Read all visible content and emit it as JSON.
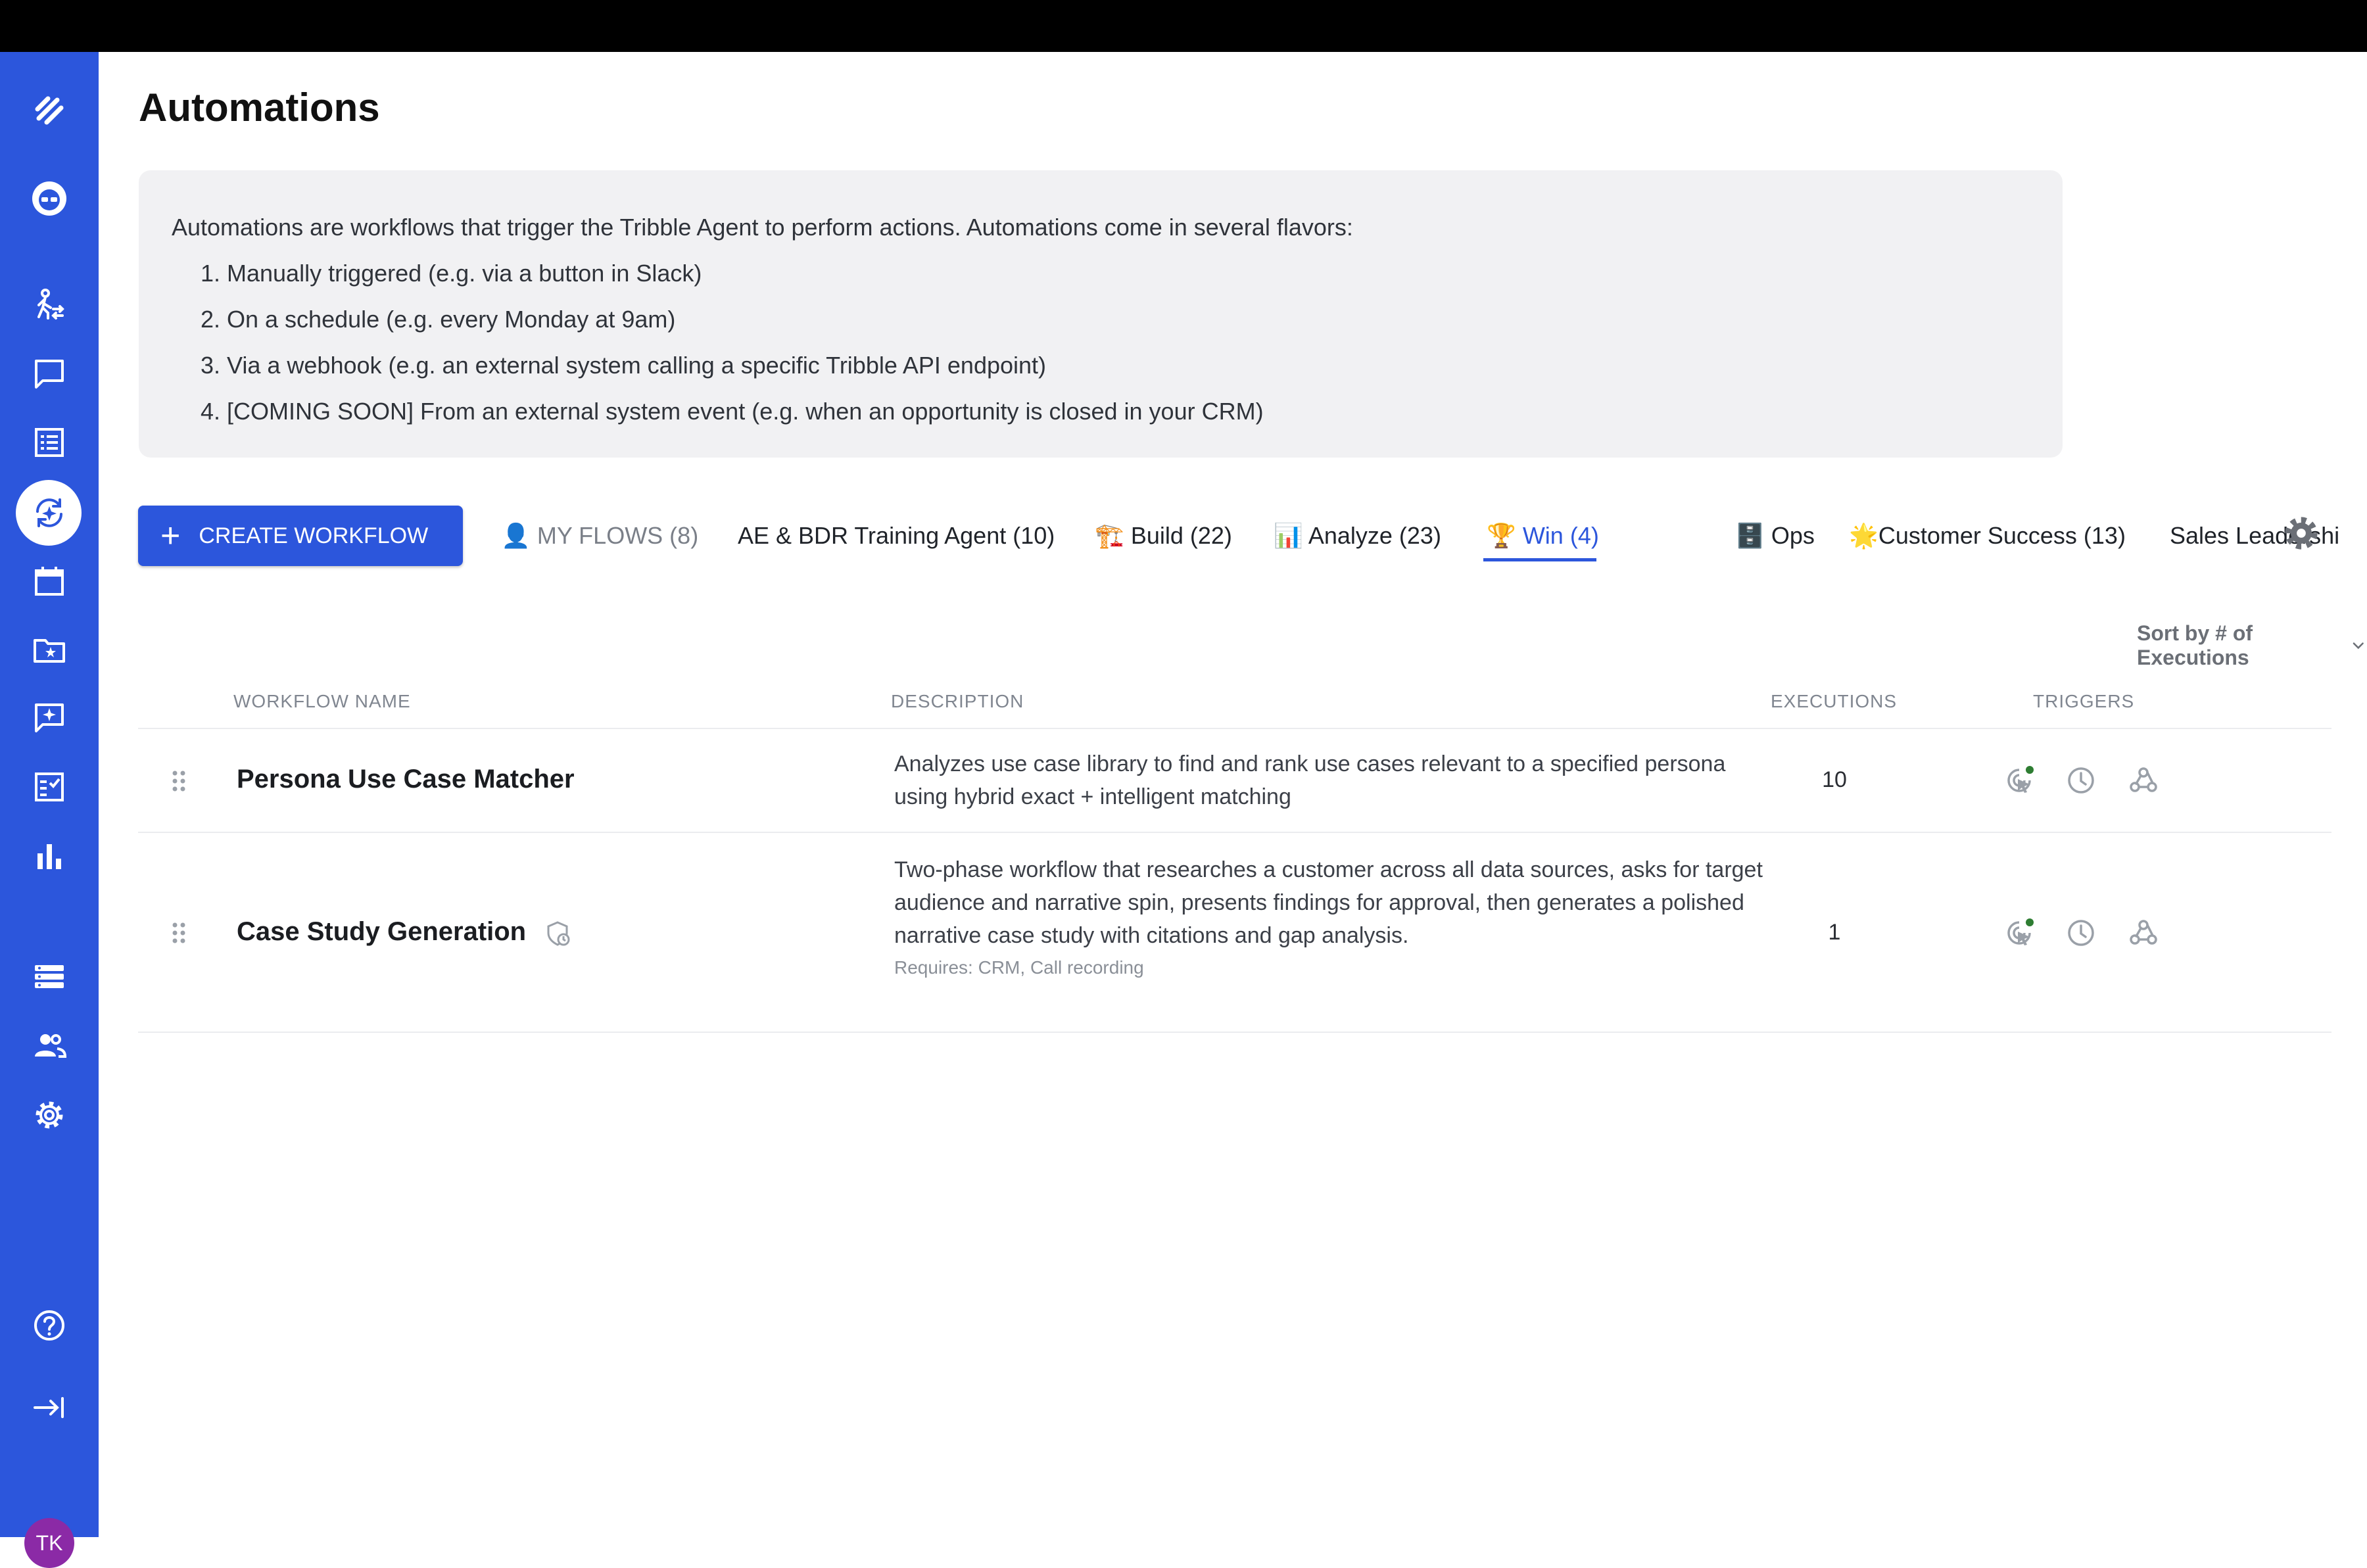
{
  "page": {
    "title": "Automations"
  },
  "info": {
    "intro": "Automations are workflows that trigger the Tribble Agent to perform actions. Automations come in several flavors:",
    "items": [
      "Manually triggered (e.g. via a button in Slack)",
      "On a schedule (e.g. every Monday at 9am)",
      "Via a webhook (e.g. an external system calling a specific Tribble API endpoint)",
      "[COMING SOON] From an external system event (e.g. when an opportunity is closed in your CRM)"
    ]
  },
  "toolbar": {
    "create_label": "CREATE WORKFLOW",
    "sort_label": "Sort by # of Executions"
  },
  "tabs": [
    {
      "label": "👤 MY FLOWS (8)",
      "state": "muted"
    },
    {
      "label": "AE & BDR Training Agent (10)",
      "state": "normal"
    },
    {
      "label": "🏗️ Build (22)",
      "state": "normal"
    },
    {
      "label": "📊 Analyze (23)",
      "state": "normal"
    },
    {
      "label": "🏆 Win (4)",
      "state": "active"
    },
    {
      "label": "🗄️ Ops",
      "state": "normal"
    },
    {
      "label": "🌟Customer Success (13)",
      "state": "normal"
    },
    {
      "label": "Sales Leadershi",
      "state": "normal"
    }
  ],
  "table": {
    "columns": {
      "name": "WORKFLOW NAME",
      "description": "DESCRIPTION",
      "executions": "EXECUTIONS",
      "triggers": "TRIGGERS"
    },
    "rows": [
      {
        "name": "Persona Use Case Matcher",
        "description": "Analyzes use case library to find and rank use cases relevant to a specified persona using hybrid exact + intelligent matching",
        "requires": "",
        "executions": "10",
        "triggers": [
          "manual-trigger-icon",
          "schedule-icon",
          "webhook-icon"
        ],
        "manual_active": true
      },
      {
        "name": "Case Study Generation",
        "description": "Two-phase workflow that researches a customer across all data sources, asks for target audience and narrative spin, presents findings for approval, then generates a polished narrative case study with citations and gap analysis.",
        "requires": "Requires: CRM, Call recording",
        "executions": "1",
        "triggers": [
          "manual-trigger-icon",
          "schedule-icon",
          "webhook-icon"
        ],
        "manual_active": true
      }
    ]
  },
  "user": {
    "initials": "TK"
  },
  "colors": {
    "brand": "#2c56dc",
    "active_dot": "#2e7d32",
    "avatar": "#8b2aa6"
  }
}
